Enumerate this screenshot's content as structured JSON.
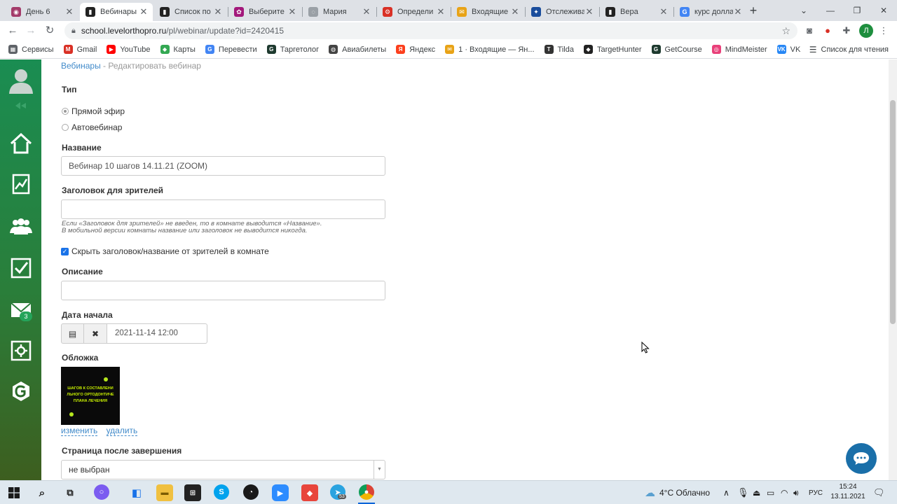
{
  "browser": {
    "tabs": [
      {
        "title": "День 6",
        "color": "#a33b6a",
        "glyph": "◉",
        "active": false
      },
      {
        "title": "Вебинары",
        "color": "#222222",
        "glyph": "▮",
        "active": true
      },
      {
        "title": "Список по",
        "color": "#222222",
        "glyph": "▮",
        "active": false
      },
      {
        "title": "Выберите",
        "color": "#a3187b",
        "glyph": "✿",
        "active": false
      },
      {
        "title": "Мария",
        "color": "#9aa0a6",
        "glyph": "◌",
        "active": false
      },
      {
        "title": "Определи",
        "color": "#d93025",
        "glyph": "⚙",
        "active": false
      },
      {
        "title": "Входящие",
        "color": "#e8a317",
        "glyph": "✉",
        "active": false
      },
      {
        "title": "Отслежива",
        "color": "#1a4d9c",
        "glyph": "✦",
        "active": false
      },
      {
        "title": "Вера",
        "color": "#222222",
        "glyph": "▮",
        "active": false
      },
      {
        "title": "курс долла",
        "color": "#4285f4",
        "glyph": "G",
        "active": false
      }
    ],
    "url_host": "school.levelorthopro.ru",
    "url_path": "/pl/webinar/update?id=2420415",
    "profile_letter": "Л",
    "bookmarks": [
      {
        "label": "Сервисы",
        "color": "#5f6368",
        "glyph": "▦"
      },
      {
        "label": "Gmail",
        "color": "#d93025",
        "glyph": "M"
      },
      {
        "label": "YouTube",
        "color": "#ff0000",
        "glyph": "▶"
      },
      {
        "label": "Карты",
        "color": "#34a853",
        "glyph": "◆"
      },
      {
        "label": "Перевести",
        "color": "#4285f4",
        "glyph": "G"
      },
      {
        "label": "Таргетолог",
        "color": "#1e3a2f",
        "glyph": "G"
      },
      {
        "label": "Авиабилеты",
        "color": "#444444",
        "glyph": "◍"
      },
      {
        "label": "Яндекс",
        "color": "#fc3f1d",
        "glyph": "Я"
      },
      {
        "label": "1 · Входящие — Ян...",
        "color": "#e8a317",
        "glyph": "✉"
      },
      {
        "label": "Tilda",
        "color": "#333333",
        "glyph": "T"
      },
      {
        "label": "TargetHunter",
        "color": "#222222",
        "glyph": "◆"
      },
      {
        "label": "GetCourse",
        "color": "#1e3a2f",
        "glyph": "G"
      },
      {
        "label": "MindMeister",
        "color": "#e9407a",
        "glyph": "◎"
      },
      {
        "label": "VK",
        "color": "#2787f5",
        "glyph": "VK"
      }
    ],
    "reading_list": "Список для чтения"
  },
  "sidebar": {
    "mail_badge": "3"
  },
  "form": {
    "breadcrumb_link": "Вебинары",
    "breadcrumb_sep": " - ",
    "breadcrumb_current": "Редактировать вебинар",
    "type_label": "Тип",
    "type_option_live": "Прямой эфир",
    "type_option_auto": "Автовебинар",
    "name_label": "Название",
    "name_value": "Вебинар 10 шагов 14.11.21 (ZOOM)",
    "viewer_title_label": "Заголовок для зрителей",
    "viewer_title_value": "",
    "viewer_title_hint1": "Если «Заголовок для зрителей» не введен, то в комнате выводится «Название».",
    "viewer_title_hint2": "В мобильной версии комнаты название или заголовок не выводится никогда.",
    "hide_title_label": "Скрыть заголовок/название от зрителей в комнате",
    "description_label": "Описание",
    "description_value": "",
    "start_date_label": "Дата начала",
    "start_date_value": "2021-11-14 12:00",
    "cover_label": "Обложка",
    "cover_line1": "ШАГОВ К СОСТАВЛЕНИ",
    "cover_line2": "ЛЬНОГО ОРТОДОНТИЧЕ",
    "cover_line3": "ПЛАНА ЛЕЧЕНИЯ",
    "cover_change": "изменить",
    "cover_delete": "удалить",
    "after_page_label": "Страница после завершения",
    "after_page_value": "не выбран"
  },
  "taskbar": {
    "weather": "4°C Облачно",
    "language": "РУС",
    "time": "15:24",
    "date": "13.11.2021",
    "telegram_badge": "53"
  }
}
